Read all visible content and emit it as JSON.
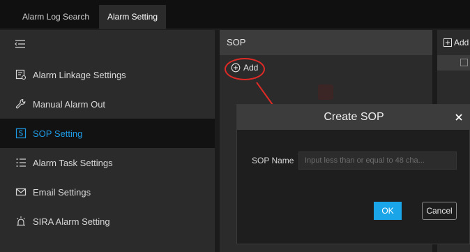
{
  "tabs": [
    {
      "label": "Alarm Log Search",
      "active": false
    },
    {
      "label": "Alarm Setting",
      "active": true
    }
  ],
  "sidebar": {
    "toggle_icon": "menu-collapse-icon",
    "items": [
      {
        "label": "Alarm Linkage Settings",
        "icon": "linkage-settings-icon",
        "active": false
      },
      {
        "label": "Manual Alarm Out",
        "icon": "wrench-icon",
        "active": false
      },
      {
        "label": "SOP Setting",
        "icon": "sop-icon",
        "active": true
      },
      {
        "label": "Alarm Task Settings",
        "icon": "task-list-icon",
        "active": false
      },
      {
        "label": "Email Settings",
        "icon": "envelope-icon",
        "active": false
      },
      {
        "label": "SIRA Alarm Setting",
        "icon": "alarm-light-icon",
        "active": false
      }
    ]
  },
  "sop_panel": {
    "title": "SOP",
    "add_label": "Add"
  },
  "right_panel": {
    "add_label": "Add"
  },
  "dialog": {
    "title": "Create SOP",
    "field_label": "SOP Name",
    "field_placeholder": "Input less than or equal to 48 cha...",
    "field_value": "",
    "ok_label": "OK",
    "cancel_label": "Cancel"
  },
  "colors": {
    "accent": "#1e9be6",
    "ok_button": "#1aa5e8",
    "annotation": "#e02a25"
  }
}
